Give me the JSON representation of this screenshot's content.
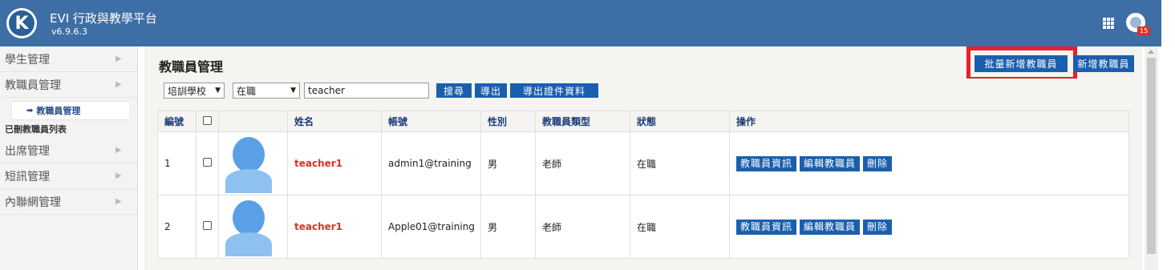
{
  "app": {
    "title": "EVI 行政與教學平台",
    "version": "v6.9.6.3",
    "notification_count": "15"
  },
  "sidebar": {
    "items": [
      {
        "label": "學生管理"
      },
      {
        "label": "教職員管理"
      },
      {
        "label": "出席管理"
      },
      {
        "label": "短訊管理"
      },
      {
        "label": "內聯網管理"
      }
    ],
    "sub_active": "教職員管理",
    "sub_other": "已刪教職員列表"
  },
  "main": {
    "title": "教職員管理",
    "batch_add_label": "批量新增教職員",
    "add_label": "新增教職員"
  },
  "filters": {
    "school": "培訓學校",
    "status": "在職",
    "search_value": "teacher",
    "search_label": "搜尋",
    "export_label": "導出",
    "export_cert_label": "導出證件資料"
  },
  "table": {
    "headers": [
      "編號",
      "",
      "",
      "姓名",
      "帳號",
      "性別",
      "教職員類型",
      "狀態",
      "操作"
    ],
    "rows": [
      {
        "no": "1",
        "name": "teacher1",
        "account": "admin1@training",
        "gender": "男",
        "type": "老師",
        "status": "在職"
      },
      {
        "no": "2",
        "name": "teacher1",
        "account": "Apple01@training",
        "gender": "男",
        "type": "老師",
        "status": "在職"
      }
    ],
    "actions": {
      "info": "教職員資訊",
      "edit": "編輯教職員",
      "delete": "刪除"
    }
  },
  "colors": {
    "topbar": "#3d6ea5",
    "button": "#1a5fae",
    "highlight": "#e8202a",
    "name_red": "#d9322b"
  }
}
